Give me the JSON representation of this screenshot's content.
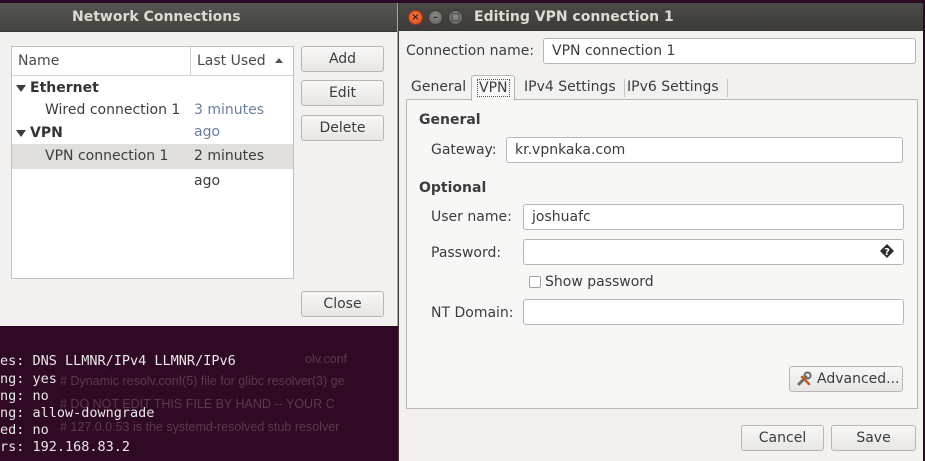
{
  "terminal": {
    "lines": [
      "es: DNS LLMNR/IPv4 LLMNR/IPv6",
      "ng: yes",
      "ng: no",
      "ng: allow-downgrade",
      "ed: no",
      "rs: 192.168.83.2"
    ],
    "ghost_lines": [
      "olv.conf",
      "# Dynamic resolv.conf(5) file for glibc resolver(3) ge",
      "# DO NOT EDIT THIS FILE BY HAND -- YOUR C",
      "# 127.0.0.53 is the systemd-resolved stub resolver"
    ]
  },
  "network_connections": {
    "title": "Network Connections",
    "columns": {
      "name": "Name",
      "last_used": "Last Used"
    },
    "groups": [
      {
        "label": "Ethernet",
        "items": [
          {
            "name": "Wired connection 1",
            "last_used": "3 minutes ago"
          }
        ]
      },
      {
        "label": "VPN",
        "items": [
          {
            "name": "VPN connection 1",
            "last_used": "2 minutes ago"
          }
        ]
      }
    ],
    "buttons": {
      "add": "Add",
      "edit": "Edit",
      "delete": "Delete",
      "close": "Close"
    }
  },
  "vpn_editor": {
    "title": "Editing VPN connection 1",
    "connection_name_label": "Connection name:",
    "connection_name_value": "VPN connection 1",
    "tabs": [
      "General",
      "VPN",
      "IPv4 Settings",
      "IPv6 Settings"
    ],
    "active_tab": "VPN",
    "general_heading": "General",
    "gateway_label": "Gateway:",
    "gateway_value": "kr.vpnkaka.com",
    "optional_heading": "Optional",
    "username_label": "User name:",
    "username_value": "joshuafc",
    "password_label": "Password:",
    "password_value": "",
    "show_password_label": "Show password",
    "show_password_checked": false,
    "nt_domain_label": "NT Domain:",
    "nt_domain_value": "",
    "advanced_label": "Advanced...",
    "cancel_label": "Cancel",
    "save_label": "Save"
  },
  "colors": {
    "close_button": "#dd4814",
    "titlebar": "#3c3b37",
    "terminal_bg": "#300a24"
  }
}
